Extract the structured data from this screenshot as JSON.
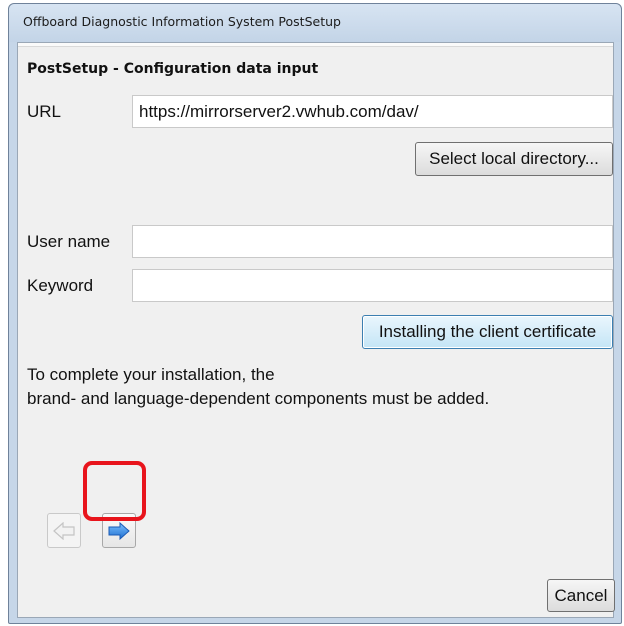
{
  "window": {
    "title": "Offboard Diagnostic Information System PostSetup"
  },
  "form": {
    "header": "PostSetup - Configuration data input",
    "url_label": "URL",
    "url_value": "https://mirrorserver2.vwhub.com/dav/",
    "select_dir_label": "Select local directory...",
    "username_label": "User name",
    "username_value": "",
    "keyword_label": "Keyword",
    "keyword_value": "",
    "certificate_label": "Installing the client certificate",
    "info_line1": "To complete your installation, the",
    "info_line2": "brand- and language-dependent components must be added."
  },
  "footer": {
    "back_icon": "arrow-left-icon",
    "next_icon": "arrow-right-icon",
    "cancel_label": "Cancel"
  },
  "colors": {
    "highlight": "#e8141c",
    "next_arrow": "#2f7fd8"
  }
}
